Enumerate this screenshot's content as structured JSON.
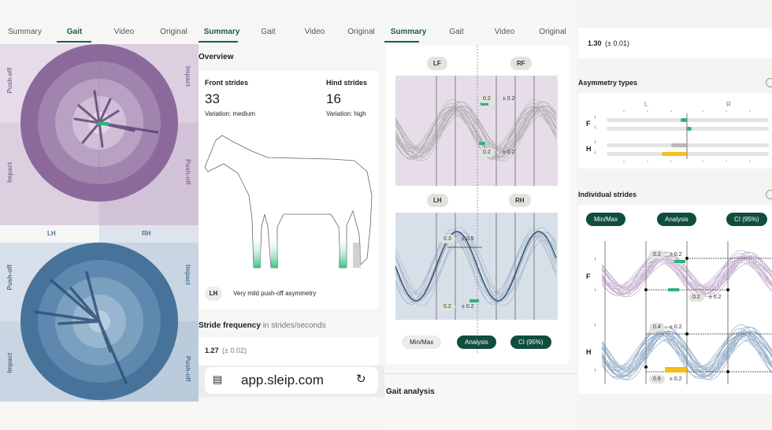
{
  "panel1": {
    "tabs": [
      "Summary",
      "Gait",
      "Video",
      "Original"
    ],
    "labels": {
      "push_off_tl": "Push-off",
      "impact_tr": "Impact",
      "impact_ml": "Impact",
      "push_off_mr": "Push-off",
      "lh": "LH",
      "rh": "RH",
      "push_off_bl": "Push-off",
      "impact_br": "Impact",
      "impact_bl": "Impact",
      "push_off_br": "Push-off"
    },
    "colors": {
      "purple": "#8d6c9c",
      "blue": "#47739b",
      "green": "#2db37a"
    }
  },
  "panel2": {
    "tabs": [
      "Summary",
      "Gait",
      "Video",
      "Original"
    ],
    "overview": "Overview",
    "front_strides_label": "Front strides",
    "front_strides_value": "33",
    "front_variation": "Variation: medium",
    "hind_strides_label": "Hind strides",
    "hind_strides_value": "16",
    "hind_variation": "Variation: high",
    "lh_badge": "LH",
    "lh_text": "Very mild push-off asymmetry",
    "stride_frequency_label": "Stride frequency",
    "stride_frequency_unit": "in strides/seconds",
    "stride_value": "1.27",
    "stride_ci": "(± 0.02)",
    "url": "app.sleip.com"
  },
  "panel3": {
    "tabs": [
      "Summary",
      "Gait",
      "Video",
      "Original"
    ],
    "lf": "LF",
    "rf": "RF",
    "lh": "LH",
    "rh": "RH",
    "front_upper_val": "0.2",
    "front_upper_ci": "± 0.2",
    "front_lower_val": "0.2",
    "front_lower_ci": "± 0.2",
    "hind_upper_val": "0.3",
    "hind_upper_ci": "± 0.5",
    "hind_lower_val": "0.2",
    "hind_lower_ci": "± 0.2",
    "btn_minmax": "Min/Max",
    "btn_analysis": "Analysis",
    "btn_ci": "CI (95%)",
    "gait_analysis": "Gait analysis"
  },
  "panel4": {
    "top_value": "1.30",
    "top_ci": "(± 0.01)",
    "asym_title": "Asymmetry types",
    "l": "L",
    "r": "R",
    "f": "F",
    "h": "H",
    "individual_title": "Individual strides",
    "btn_minmax": "Min/Max",
    "btn_analysis": "Analysis",
    "btn_ci": "CI (95%)",
    "f_val": "0.2",
    "f_ci": "± 0.2",
    "f_val2": "0.2",
    "f_ci2": "± 0.2",
    "h_val": "0.4",
    "h_ci": "± 0.2",
    "h_val2": "0.6",
    "h_ci2": "± 0.2",
    "arrow_up": "↑",
    "arrow_down": "↓"
  }
}
